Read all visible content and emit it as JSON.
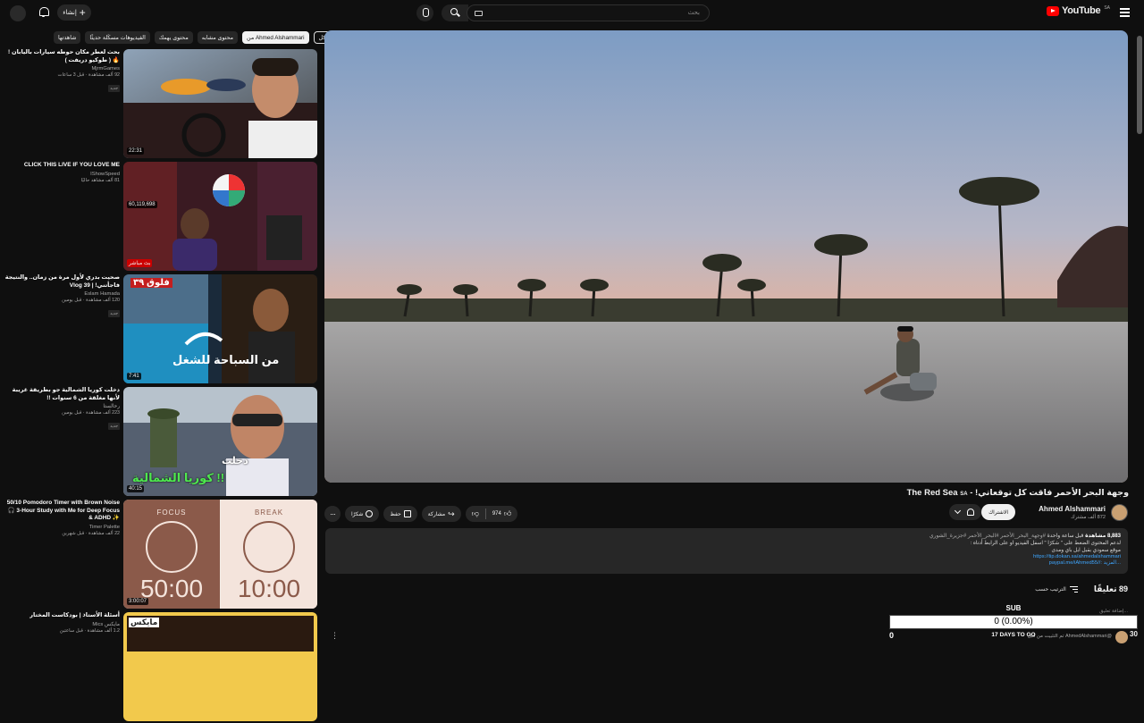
{
  "header": {
    "logo_text": "YouTube",
    "country_code": "SA",
    "search_placeholder": "بحث",
    "create_label": "إنشاء"
  },
  "chips": [
    "الكل",
    "من Ahmed Alshammari",
    "محتوى مشابه",
    "محتوى يهمك",
    "الفيديوهات مسكَلة حديثًا",
    "شاهدتها"
  ],
  "sidebar": {
    "items": [
      {
        "title": "بحث لعطر مكان حوطه سيارات باليابان ! 🔥 ( طوكيو دريفت )",
        "channel": "MjrmGames",
        "views": "92 ألف مشاهدة",
        "age": "قبل 3 ساعات",
        "badge": "جديد",
        "duration": "22:31"
      },
      {
        "title": "CLICK THIS LIVE IF YOU LOVE ME",
        "channel": "IShowSpeed",
        "views": "81 ألف مشاهد حاليًا",
        "age": "",
        "badge": "",
        "duration": "60,119,698"
      },
      {
        "title": "صحيت بدري لأول مرة من زمان.. والنتيجة فاجأتني! | Vlog 39",
        "channel": "Eslam Hamada",
        "views": "120 ألف مشاهدة",
        "age": "قبل يومين",
        "badge": "جديد",
        "duration": "7:41"
      },
      {
        "title": "دخلت كوريا الشمالية جو بطريقة غريبة لأنها مغلقة من 6 سنوات !!",
        "channel": "رحالستا",
        "views": "223 ألف مشاهدة",
        "age": "قبل يومين",
        "badge": "جديد",
        "duration": "40:15"
      },
      {
        "title": "50/10 Pomodoro Timer with Brown Noise 🎧 3-Hour Study with Me for Deep Focus & ADHD ✨",
        "channel": "Timer Palette",
        "views": "22 ألف مشاهدة",
        "age": "قبل شهرين",
        "badge": "",
        "duration": "3:00:07"
      },
      {
        "title": "أسئلة الأستاذ | بودكاست المختار",
        "channel": "مايكس Mics",
        "views": "1.2 ألف مشاهدة",
        "age": "قبل ساعتين",
        "badge": "",
        "duration": ""
      }
    ],
    "thumb_texts": {
      "t3_top": "فلوق ٣٩",
      "t3_main": "من السباحة للشغل",
      "t4_main_a": "دخلت",
      "t4_main_b": "كوريا الشمالية !!",
      "focus": "FOCUS",
      "focus_time": "50:00",
      "break": "BREAK",
      "break_time": "10:00",
      "live_badge": "بث مباشر",
      "t6_top": "مايكس"
    }
  },
  "video": {
    "title": "وجهة البحر الأحمر فاقت كل توقعاتي! - The Red Sea",
    "title_tag": "SA",
    "channel": "Ahmed Alshammari",
    "subscribers": "872 ألف مشترك",
    "subscribe_label": "الاشتراك",
    "likes": "974",
    "share_label": "مشاركة",
    "save_label": "حفظ",
    "thanks_label": "شكرًا",
    "description": {
      "views": "8,883 مشاهدة",
      "age": "قبل ساعة واحدة",
      "hashtags": "#وجهة_البحر_الأحمر #البحر_الأحمر #جزيرة_الشوري",
      "line2": "لدعم المحتوى الضغط على \" شكرًا \" اسفل الفيديو او على الرابط أدناه :",
      "line3": "موقع سعودي بقبل ابل باي ومدى",
      "link1": "https://tip.dokan.sa/ahmedalshammari",
      "link2": "...المزيد  ://paypal.me/iAhmed55"
    }
  },
  "comments": {
    "count": "89 تعليقًا",
    "sort_label": "الترتيب حسب",
    "add_placeholder": "إضافة تعليق...",
    "pinned": "@AhmedAlshammari تم التثبيت من قبل"
  },
  "overlay": {
    "label": "SUB",
    "progress_text": "0 (0.00%)",
    "progress_fraction": 0,
    "left_value": "0",
    "goal_text": "17 DAYS TO GO",
    "right_value": "30"
  },
  "colors": {
    "background": "#0f0f0f",
    "surface": "#272727",
    "brand_red": "#ff0000",
    "link": "#3ea6ff"
  }
}
